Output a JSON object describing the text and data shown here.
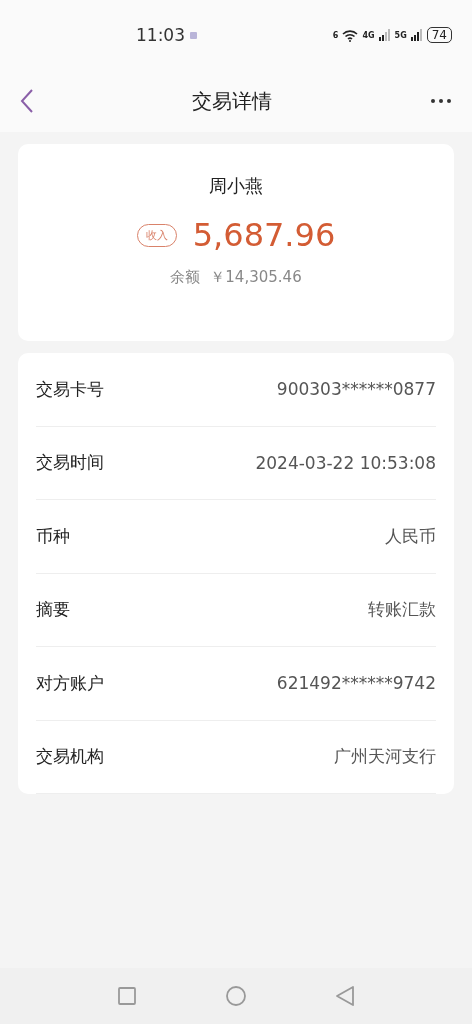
{
  "status_bar": {
    "time": "11:03",
    "wifi_label": "6",
    "network_1": "4G",
    "network_2": "5G",
    "battery": "74"
  },
  "nav": {
    "title": "交易详情"
  },
  "summary": {
    "name": "周小燕",
    "tag": "收入",
    "amount": "5,687.96",
    "balance_label": "余额",
    "balance": "￥14,305.46"
  },
  "details": [
    {
      "label": "交易卡号",
      "value": "900303******0877"
    },
    {
      "label": "交易时间",
      "value": "2024-03-22 10:53:08"
    },
    {
      "label": "币种",
      "value": "人民币"
    },
    {
      "label": "摘要",
      "value": "转账汇款"
    },
    {
      "label": "对方账户",
      "value": "621492******9742"
    },
    {
      "label": "交易机构",
      "value": "广州天河支行"
    }
  ]
}
